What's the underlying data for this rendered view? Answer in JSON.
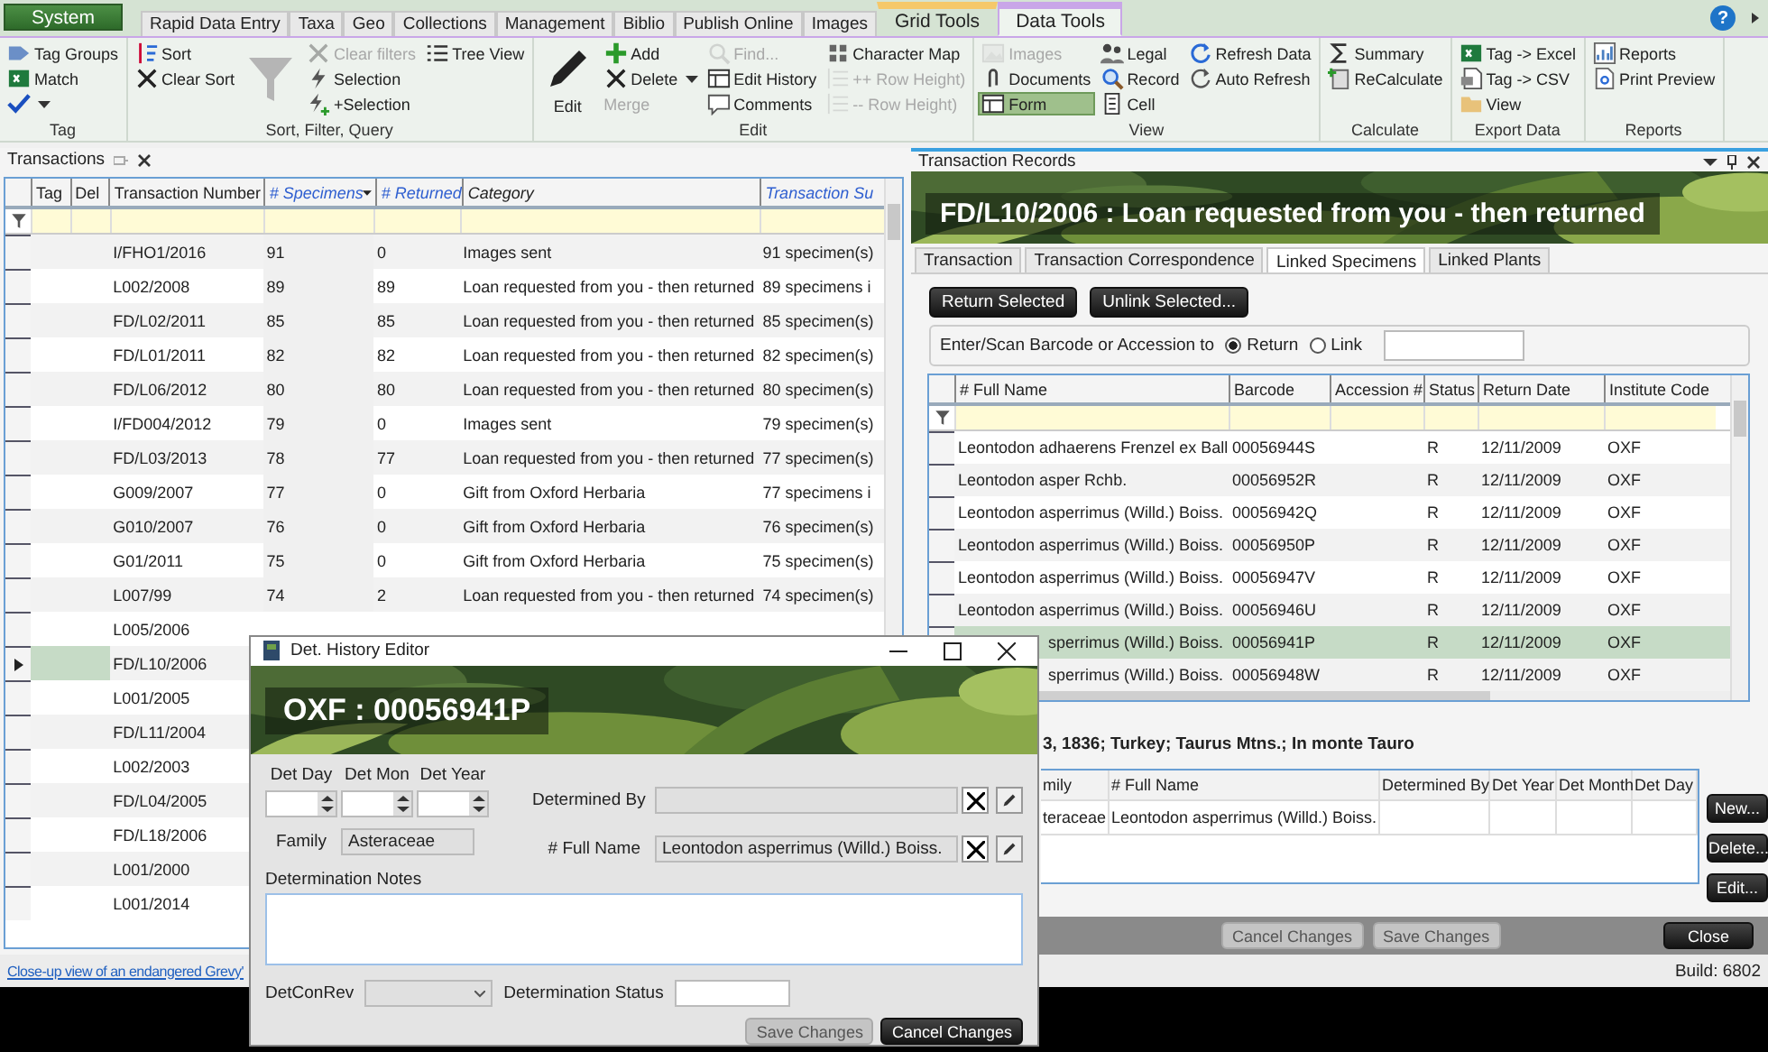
{
  "ribbon": {
    "tabs": [
      {
        "label": "System",
        "kind": "app",
        "selected": false
      },
      {
        "label": "Rapid Data Entry",
        "kind": "tab",
        "selected": false
      },
      {
        "label": "Taxa",
        "kind": "tab",
        "selected": false
      },
      {
        "label": "Geo",
        "kind": "tab",
        "selected": false
      },
      {
        "label": "Collections",
        "kind": "tab",
        "selected": false
      },
      {
        "label": "Management",
        "kind": "tab",
        "selected": false
      },
      {
        "label": "Biblio",
        "kind": "tab",
        "selected": false
      },
      {
        "label": "Publish Online",
        "kind": "tab",
        "selected": false
      },
      {
        "label": "Images",
        "kind": "tab",
        "selected": false
      },
      {
        "label": "Grid Tools",
        "kind": "context",
        "color": "#f5c86a",
        "selected": false
      },
      {
        "label": "Data Tools",
        "kind": "context",
        "color": "#c9a6e8",
        "selected": true
      }
    ],
    "help": "?",
    "groups": [
      {
        "label": "Tag",
        "columns": [
          [
            {
              "label": "Tag Groups",
              "kind": "small",
              "disabled": false,
              "on": false
            },
            {
              "label": "Match",
              "kind": "small",
              "disabled": false,
              "on": false
            },
            {
              "kind": "split",
              "disabled": false,
              "on": false
            }
          ]
        ]
      },
      {
        "label": "Sort, Filter, Query",
        "columns": [
          [
            {
              "label": "Sort",
              "kind": "small",
              "disabled": false,
              "on": false
            },
            {
              "label": "Clear Sort",
              "kind": "small",
              "disabled": false,
              "on": false
            }
          ],
          [
            {
              "kind": "large",
              "disabled": false,
              "on": false
            }
          ],
          [
            {
              "label": "Clear filters",
              "kind": "small",
              "disabled": true,
              "on": false
            },
            {
              "label": "Selection",
              "kind": "small",
              "disabled": false,
              "on": false
            },
            {
              "label": "+Selection",
              "kind": "small",
              "disabled": false,
              "on": false
            }
          ],
          [
            {
              "label": "Tree View",
              "kind": "small",
              "disabled": false,
              "on": false
            }
          ]
        ]
      },
      {
        "label": "Edit",
        "columns": [
          [
            {
              "label": "Edit",
              "kind": "large",
              "disabled": false,
              "on": false
            }
          ],
          [
            {
              "label": "Add",
              "kind": "small",
              "disabled": false,
              "on": false
            },
            {
              "label": "Delete",
              "kind": "split",
              "disabled": false,
              "on": false
            },
            {
              "label": "Merge",
              "kind": "small",
              "disabled": true,
              "on": false
            }
          ],
          [
            {
              "label": "Find...",
              "kind": "small",
              "disabled": true,
              "on": false
            },
            {
              "label": "Edit History",
              "kind": "small",
              "disabled": false,
              "on": false
            },
            {
              "label": "Comments",
              "kind": "small",
              "disabled": false,
              "on": false
            }
          ],
          [
            {
              "label": "Character Map",
              "kind": "small",
              "disabled": false,
              "on": false
            },
            {
              "label": "++ Row Height)",
              "kind": "small",
              "disabled": true,
              "on": false
            },
            {
              "label": "-- Row Height)",
              "kind": "small",
              "disabled": true,
              "on": false
            }
          ]
        ]
      },
      {
        "label": "View",
        "columns": [
          [
            {
              "label": "Images",
              "kind": "small",
              "disabled": true,
              "on": false
            },
            {
              "label": "Documents",
              "kind": "small",
              "disabled": false,
              "on": false
            },
            {
              "label": "Form",
              "kind": "small",
              "disabled": false,
              "on": true
            }
          ],
          [
            {
              "label": "Legal",
              "kind": "small",
              "disabled": false,
              "on": false
            },
            {
              "label": "Record",
              "kind": "small",
              "disabled": false,
              "on": false
            },
            {
              "label": "Cell",
              "kind": "small",
              "disabled": false,
              "on": false
            }
          ],
          [
            {
              "label": "Refresh Data",
              "kind": "small",
              "disabled": false,
              "on": false
            },
            {
              "label": "Auto Refresh",
              "kind": "small",
              "disabled": false,
              "on": false
            }
          ]
        ]
      },
      {
        "label": "Calculate",
        "columns": [
          [
            {
              "label": "Summary",
              "kind": "small",
              "disabled": false,
              "on": false
            },
            {
              "label": "ReCalculate",
              "kind": "small",
              "disabled": false,
              "on": false
            }
          ]
        ]
      },
      {
        "label": "Export Data",
        "columns": [
          [
            {
              "label": "Tag -> Excel",
              "kind": "small",
              "disabled": false,
              "on": false
            },
            {
              "label": "Tag -> CSV",
              "kind": "small",
              "disabled": false,
              "on": false
            },
            {
              "label": "View",
              "kind": "small",
              "disabled": false,
              "on": false
            }
          ]
        ]
      },
      {
        "label": "Reports",
        "columns": [
          [
            {
              "label": "Reports",
              "kind": "small",
              "disabled": false,
              "on": false
            },
            {
              "label": "Print Preview",
              "kind": "small",
              "disabled": false,
              "on": false
            }
          ]
        ]
      }
    ]
  },
  "transactions": {
    "title": "Transactions",
    "columns": [
      {
        "label": "Tag",
        "kind": "plain",
        "sorted": false
      },
      {
        "label": "Del",
        "kind": "plain",
        "sorted": false
      },
      {
        "label": "Transaction Number",
        "kind": "plain",
        "sorted": false
      },
      {
        "label": "# Specimens",
        "kind": "calculated",
        "sorted": true
      },
      {
        "label": "# Returned",
        "kind": "calculated",
        "sorted": false
      },
      {
        "label": "Category",
        "kind": "lookup",
        "sorted": false
      },
      {
        "label": "Transaction Su",
        "kind": "calculated",
        "sorted": false
      }
    ],
    "rows": [
      {
        "number": "I/FHO1/2016",
        "specimens": "91",
        "returned": "0",
        "category": "Images sent",
        "summary": "91 specimen(s)",
        "selected": false
      },
      {
        "number": "L002/2008",
        "specimens": "89",
        "returned": "89",
        "category": "Loan requested from you - then returned",
        "summary": "89 specimens i",
        "selected": false
      },
      {
        "number": "FD/L02/2011",
        "specimens": "85",
        "returned": "85",
        "category": "Loan requested from you - then returned",
        "summary": "85 specimen(s)",
        "selected": false
      },
      {
        "number": "FD/L01/2011",
        "specimens": "82",
        "returned": "82",
        "category": "Loan requested from you - then returned",
        "summary": "82 specimen(s)",
        "selected": false
      },
      {
        "number": "FD/L06/2012",
        "specimens": "80",
        "returned": "80",
        "category": "Loan requested from you - then returned",
        "summary": "80 specimen(s)",
        "selected": false
      },
      {
        "number": "I/FD004/2012",
        "specimens": "79",
        "returned": "0",
        "category": "Images sent",
        "summary": "79 specimen(s)",
        "selected": false
      },
      {
        "number": "FD/L03/2013",
        "specimens": "78",
        "returned": "77",
        "category": "Loan requested from you - then returned",
        "summary": "77 specimen(s)",
        "selected": false
      },
      {
        "number": "G009/2007",
        "specimens": "77",
        "returned": "0",
        "category": "Gift from Oxford Herbaria",
        "summary": "77 specimens i",
        "selected": false
      },
      {
        "number": "G010/2007",
        "specimens": "76",
        "returned": "0",
        "category": "Gift from Oxford Herbaria",
        "summary": "76 specimen(s)",
        "selected": false
      },
      {
        "number": "G01/2011",
        "specimens": "75",
        "returned": "0",
        "category": "Gift from Oxford Herbaria",
        "summary": "75 specimen(s)",
        "selected": false
      },
      {
        "number": "L007/99",
        "specimens": "74",
        "returned": "2",
        "category": "Loan requested from you - then returned",
        "summary": "74 specimen(s)",
        "selected": false
      },
      {
        "number": "L005/2006",
        "selected": false
      },
      {
        "number": "FD/L10/2006",
        "selected": true
      },
      {
        "number": "L001/2005",
        "selected": false
      },
      {
        "number": "FD/L11/2004",
        "selected": false
      },
      {
        "number": "L002/2003",
        "selected": false
      },
      {
        "number": "FD/L04/2005",
        "selected": false
      },
      {
        "number": "FD/L18/2006",
        "selected": false
      },
      {
        "number": "L001/2000",
        "selected": false
      },
      {
        "number": "L001/2014",
        "selected": false
      }
    ]
  },
  "records": {
    "title": "Transaction Records",
    "heading": "FD/L10/2006 :  Loan requested from you - then returned",
    "tabs": [
      {
        "label": "Transaction",
        "selected": false
      },
      {
        "label": "Transaction Correspondence",
        "selected": false
      },
      {
        "label": "Linked Specimens",
        "selected": true
      },
      {
        "label": "Linked Plants",
        "selected": false
      }
    ],
    "buttons": [
      "Return Selected",
      "Unlink Selected..."
    ],
    "scan": {
      "label": "Enter/Scan Barcode or Accession to",
      "options": [
        {
          "label": "Return",
          "selected": true
        },
        {
          "label": "Link",
          "selected": false
        }
      ]
    },
    "specimens": {
      "columns": [
        "# Full Name",
        "Barcode",
        "Accession #",
        "Status",
        "Return Date",
        "Institute Code"
      ],
      "rows": [
        {
          "name": "Leontodon adhaerens Frenzel ex Ball",
          "barcode": "00056944S",
          "status": "R",
          "return_date": "12/11/2009",
          "institute": "OXF",
          "selected": false
        },
        {
          "name": "Leontodon asper Rchb.",
          "barcode": "00056952R",
          "status": "R",
          "return_date": "12/11/2009",
          "institute": "OXF",
          "selected": false
        },
        {
          "name": "Leontodon asperrimus (Willd.) Boiss.",
          "barcode": "00056942Q",
          "status": "R",
          "return_date": "12/11/2009",
          "institute": "OXF",
          "selected": false
        },
        {
          "name": "Leontodon asperrimus (Willd.) Boiss.",
          "barcode": "00056950P",
          "status": "R",
          "return_date": "12/11/2009",
          "institute": "OXF",
          "selected": false
        },
        {
          "name": "Leontodon asperrimus (Willd.) Boiss.",
          "barcode": "00056947V",
          "status": "R",
          "return_date": "12/11/2009",
          "institute": "OXF",
          "selected": false
        },
        {
          "name": "Leontodon asperrimus (Willd.) Boiss.",
          "barcode": "00056946U",
          "status": "R",
          "return_date": "12/11/2009",
          "institute": "OXF",
          "selected": false
        },
        {
          "name": "sperrimus (Willd.) Boiss.",
          "barcode": "00056941P",
          "status": "R",
          "return_date": "12/11/2009",
          "institute": "OXF",
          "selected": true
        },
        {
          "name": "sperrimus (Willd.) Boiss.",
          "barcode": "00056948W",
          "status": "R",
          "return_date": "12/11/2009",
          "institute": "OXF",
          "selected": false
        }
      ]
    },
    "locality": "3, 1836; Turkey; Taurus Mtns.; In monte Tauro",
    "determinations": {
      "columns": [
        "mily",
        "# Full Name",
        "Determined By",
        "Det Year",
        "Det Month",
        "Det Day"
      ],
      "rows": [
        {
          "family": "teraceae",
          "full_name": "Leontodon asperrimus (Willd.) Boiss."
        }
      ]
    },
    "side_buttons": [
      "New...",
      "Delete...",
      "Edit..."
    ],
    "footer_buttons": [
      {
        "label": "Cancel Changes",
        "disabled": true
      },
      {
        "label": "Save Changes",
        "disabled": true
      },
      {
        "label": "Close",
        "disabled": false
      }
    ]
  },
  "status_bar": {
    "caption": "Close-up view of an endangered Grevy'",
    "build": "Build: 6802"
  },
  "det_editor": {
    "title": "Det. History Editor",
    "heading": "OXF :  00056941P",
    "date_fields": [
      "Det Day",
      "Det Mon",
      "Det Year"
    ],
    "family": {
      "label": "Family",
      "value": "Asteraceae"
    },
    "determined_by": {
      "label": "Determined By"
    },
    "full_name": {
      "label": "# Full Name",
      "value": "Leontodon asperrimus (Willd.) Boiss."
    },
    "notes": {
      "label": "Determination Notes"
    },
    "det_con_rev": {
      "label": "DetConRev"
    },
    "status": {
      "label": "Determination Status"
    },
    "buttons": [
      {
        "label": "Save Changes",
        "disabled": true
      },
      {
        "label": "Cancel Changes",
        "disabled": false
      }
    ]
  }
}
